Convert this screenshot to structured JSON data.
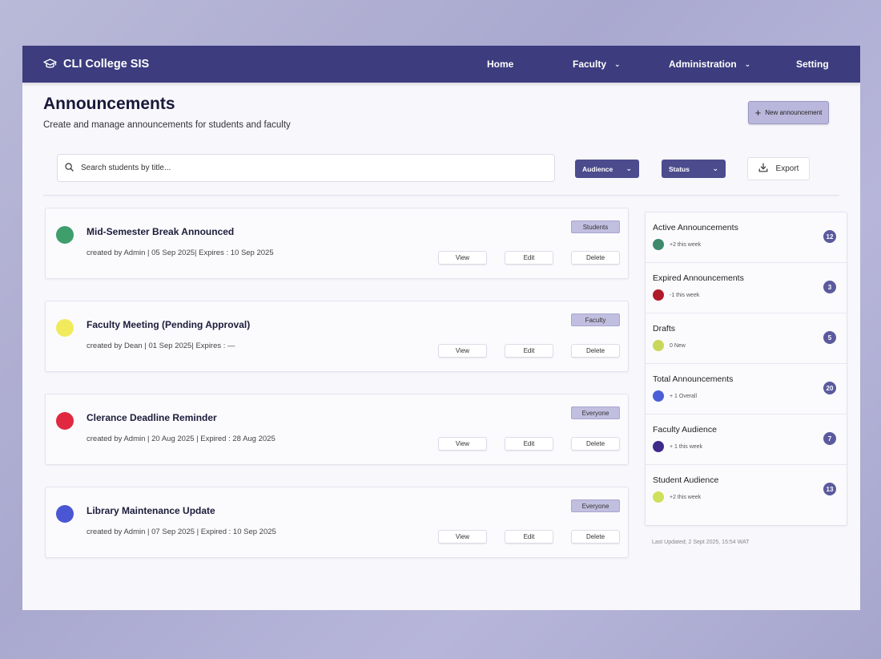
{
  "app": {
    "title": "CLI College SIS",
    "logo_icon": "graduation-cap-icon"
  },
  "nav": {
    "home": "Home",
    "faculty": "Faculty",
    "administration": "Administration",
    "setting": "Setting"
  },
  "page": {
    "title": "Announcements",
    "subtitle": "Create and manage announcements for students and faculty",
    "new_button": "New announcement"
  },
  "toolbar": {
    "search_placeholder": "Search students by title...",
    "audience_label": "Audience",
    "status_label": "Status",
    "export_label": "Export"
  },
  "announcements": [
    {
      "title": "Mid-Semester Break Announced",
      "meta": "created by Admin | 05 Sep 2025| Expires : 10 Sep 2025",
      "badge": "Students",
      "status_color": "#3e9e6c",
      "view": "View",
      "edit": "Edit",
      "delete": "Delete"
    },
    {
      "title": "Faculty Meeting (Pending Approval)",
      "meta": "created by Dean | 01 Sep 2025| Expires :    —",
      "badge": "Faculty",
      "status_color": "#f1ea5c",
      "view": "View",
      "edit": "Edit",
      "delete": "Delete"
    },
    {
      "title": "Clerance Deadline Reminder",
      "meta": "created by Admin | 20 Aug 2025 | Expired : 28 Aug 2025",
      "badge": "Everyone",
      "status_color": "#e02840",
      "view": "View",
      "edit": "Edit",
      "delete": "Delete"
    },
    {
      "title": "Library Maintenance Update",
      "meta": "created by Admin | 07 Sep 2025 | Expired : 10 Sep 2025",
      "badge": "Everyone",
      "status_color": "#4a56d4",
      "view": "View",
      "edit": "Edit",
      "delete": "Delete"
    }
  ],
  "stats": [
    {
      "label": "Active Announcements",
      "note": "+2 this week",
      "count": "12",
      "color": "#3e8a6a"
    },
    {
      "label": "Expired Announcements",
      "note": "-1 this week",
      "count": "3",
      "color": "#b01a28"
    },
    {
      "label": "Drafts",
      "note": "0  New",
      "count": "5",
      "color": "#c9d85a"
    },
    {
      "label": "Total Announcements",
      "note": "+ 1 Overall",
      "count": "20",
      "color": "#4a5ed8"
    },
    {
      "label": "Faculty Audience",
      "note": "+ 1 this week",
      "count": "7",
      "color": "#3f2a8c"
    },
    {
      "label": "Student Audience",
      "note": "+2 this week",
      "count": "13",
      "color": "#cfe05c"
    }
  ],
  "last_updated": "Last Updated; 2 Sept 2025, 15:54 WAT"
}
